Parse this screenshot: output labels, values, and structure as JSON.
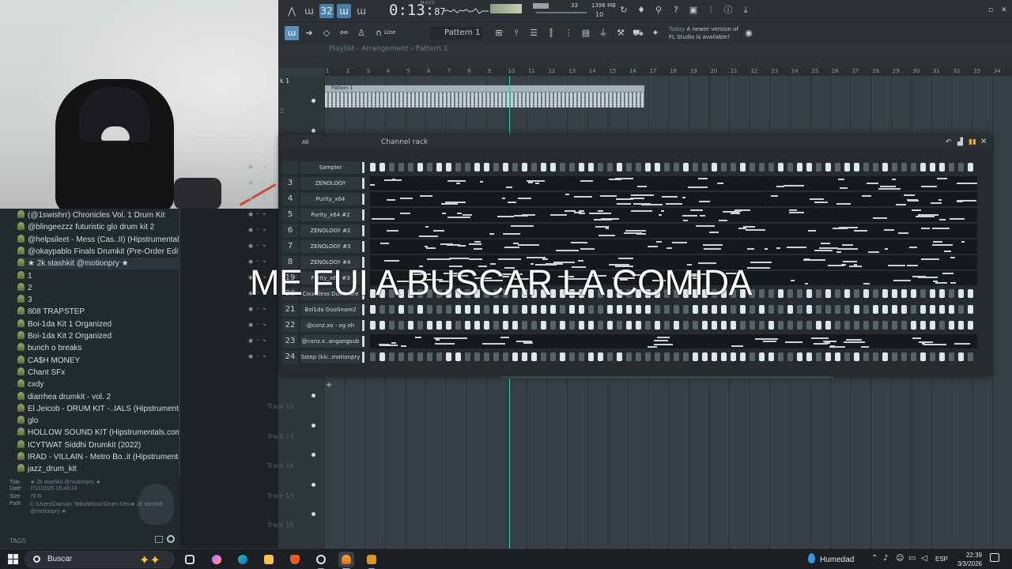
{
  "browser": {
    "items": [
      "(@1swishrr) Chronicles Vol. 1 Drum Kit",
      "@blingeezzz futuristic glo drum kit 2",
      "@helpsileet - Mess (Cas..II) (Hipstrumentals.com)",
      "@okaypablo Finals Drumkit (Pre-Order Edition)",
      "★ 2k stashkit @motionpry ★",
      "1",
      "2",
      "3",
      "808 TRAPSTEP",
      "Boi-1da Kit 1 Organized",
      "Boi-1da Kit 2 Organized",
      "bunch o breaks",
      "CA$H MONEY",
      "Chant SFx",
      "cxdy",
      "diarrhea drumkit - vol. 2",
      "El Jeicob - DRUM KIT -..IALS (Hipstrumentals.com)",
      "glo",
      "HOLLOW SOUND KIT (Hipstrumentals.com)",
      "ICYTWAT Siddhi Drumkit (2022)",
      "IRAD - VILLAIN - Metro Bo..it (Hipstrumentals.com)",
      "jazz_drum_kit"
    ],
    "info": {
      "title_label": "Title",
      "title_value": "★ 2k stashkit @motionpry ★",
      "date_label": "Date",
      "date_value": "7/11/2025 16:49:24",
      "size_label": "Size",
      "size_value": "78 B",
      "path_label": "Path",
      "path_value": "C:\\Users\\Damián Tabia\\Music\\Drum Kits\\★ 2k stashkit @motionpry ★"
    },
    "tags_label": "TAGS"
  },
  "toolbar": {
    "time_main": "0:13:",
    "time_small": "87",
    "time_unit": "M:S:CS",
    "memory": "1396 MB",
    "cpu": "10",
    "volume_num": "33",
    "snap_label": "Line",
    "pattern_label": "Pattern 1",
    "news_date": "Today",
    "news_text1": "A newer version of",
    "news_text2": "FL Studio is available!"
  },
  "playlist": {
    "title": "Playlist - Arrangement › Pattern 1",
    "ruler": [
      "1",
      "2",
      "3",
      "4",
      "5",
      "6",
      "7",
      "8",
      "9",
      "10",
      "11",
      "12",
      "13",
      "14",
      "15",
      "16",
      "17",
      "18",
      "19",
      "20",
      "21",
      "22",
      "23",
      "24",
      "25",
      "26",
      "27",
      "28",
      "29",
      "30",
      "31",
      "32",
      "33",
      "34"
    ],
    "clip_label": "Pattern 1",
    "track1_label": "k 1",
    "track2_label": "2",
    "lower_tracks": [
      "Track 12",
      "Track 13",
      "Track 14",
      "Track 15",
      "Track 16"
    ]
  },
  "channel_rack": {
    "filter_label": "All",
    "title": "Channel rack",
    "channels": [
      {
        "num": "",
        "name": "Sampler",
        "mode": "steps"
      },
      {
        "num": "3",
        "name": "ZENOLOGY",
        "mode": "roll"
      },
      {
        "num": "4",
        "name": "Purity_x64",
        "mode": "roll"
      },
      {
        "num": "5",
        "name": "Purity_x64 #2",
        "mode": "roll"
      },
      {
        "num": "6",
        "name": "ZENOLOGY #2",
        "mode": "roll"
      },
      {
        "num": "7",
        "name": "ZENOLOGY #3",
        "mode": "roll"
      },
      {
        "num": "8",
        "name": "ZENOLOGY #4",
        "mode": "roll"
      },
      {
        "num": "19",
        "name": "Purity_x64 #3",
        "mode": "roll"
      },
      {
        "num": "20",
        "name": "Countless DuoSnare",
        "mode": "steps"
      },
      {
        "num": "21",
        "name": "Boi1da DuoSnare2",
        "mode": "steps"
      },
      {
        "num": "22",
        "name": "@conz.xo - og oh",
        "mode": "steps"
      },
      {
        "num": "23",
        "name": "@conz.x..angangsub",
        "mode": "roll"
      },
      {
        "num": "24",
        "name": "Sstep (kic..motionpry",
        "mode": "steps"
      }
    ]
  },
  "overlay_text": "ME FUI A BUSCAR LA COMIDA",
  "taskbar": {
    "search_placeholder": "Buscar",
    "weather": "Humedad",
    "lang": "ESP",
    "time": "22:39",
    "date": "3/3/2026"
  },
  "colors": {
    "accent": "#4b7fa6",
    "playhead": "#3cc2b4",
    "step_on": "#dfe7ea",
    "step_off": "#59636a"
  }
}
